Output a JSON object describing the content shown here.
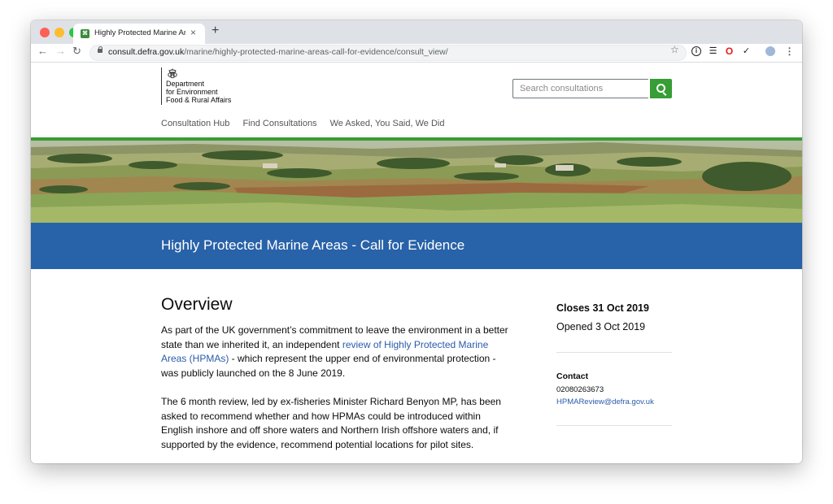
{
  "browser": {
    "tab_title": "Highly Protected Marine Areas",
    "tab_favicon_text": "⌘",
    "tab_close": "×",
    "new_tab": "+",
    "url_host": "consult.defra.gov.uk",
    "url_path": "/marine/highly-protected-marine-areas-call-for-evidence/consult_view/",
    "back": "←",
    "forward": "→",
    "reload": "↻",
    "star": "☆",
    "menu": "⋮"
  },
  "header": {
    "logo_lines": [
      "Department",
      "for Environment",
      "Food & Rural Affairs"
    ],
    "search_placeholder": "Search consultations"
  },
  "nav": {
    "items": [
      "Consultation Hub",
      "Find Consultations",
      "We Asked, You Said, We Did"
    ]
  },
  "banner": {
    "title": "Highly Protected Marine Areas - Call for Evidence"
  },
  "overview": {
    "heading": "Overview",
    "para1_before": "As part of the UK government’s commitment to leave the environment in a better state than we inherited it, an independent ",
    "para1_link": "review of Highly Protected Marine Areas (HPMAs)",
    "para1_after": " - which represent the upper end of environmental protection - was publicly launched on the 8 June 2019.",
    "para2": "The 6 month review, led by ex-fisheries Minister Richard Benyon MP, has been asked to recommend whether and how HPMAs could be introduced within English inshore and off shore waters and Northern Irish offshore waters and, if supported by the evidence, recommend potential locations for pilot sites."
  },
  "sidebar": {
    "closes": "Closes 31 Oct 2019",
    "opened": "Opened 3 Oct 2019",
    "contact_heading": "Contact",
    "contact_phone": "02080263673",
    "contact_email": "HPMAReview@defra.gov.uk"
  },
  "colors": {
    "accent_green": "#379d35",
    "banner_blue": "#2862a8",
    "link_blue": "#2b5bab"
  }
}
